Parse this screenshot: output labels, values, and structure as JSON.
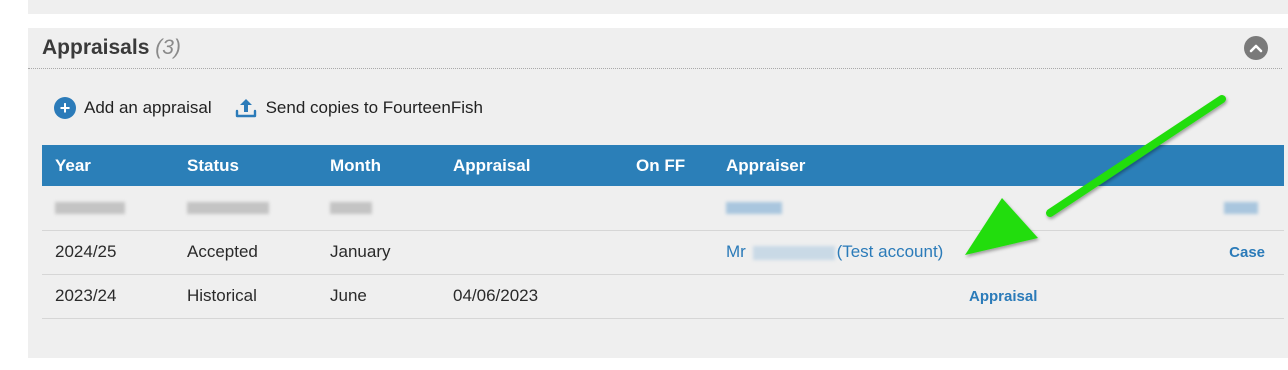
{
  "panel": {
    "title": "Appraisals",
    "count": "(3)"
  },
  "actions": {
    "add_label": "Add an appraisal",
    "send_label": "Send copies to FourteenFish"
  },
  "table": {
    "columns": [
      "Year",
      "Status",
      "Month",
      "Appraisal",
      "On FF",
      "Appraiser"
    ],
    "rows": [
      {
        "year": "2024/25",
        "status": "Accepted",
        "month": "January",
        "appraisal": "",
        "on_ff": "",
        "appraiser_prefix": "Mr",
        "appraiser_suffix": "(Test account)",
        "action": "Case"
      },
      {
        "year": "2023/24",
        "status": "Historical",
        "month": "June",
        "appraisal": "04/06/2023",
        "on_ff": "",
        "appraiser_prefix": "",
        "appraiser_suffix": "",
        "action": "Appraisal"
      }
    ]
  },
  "colors": {
    "header_bg": "#2b7fb8",
    "link": "#2b7bb9",
    "annotation_arrow": "#22dd11"
  }
}
